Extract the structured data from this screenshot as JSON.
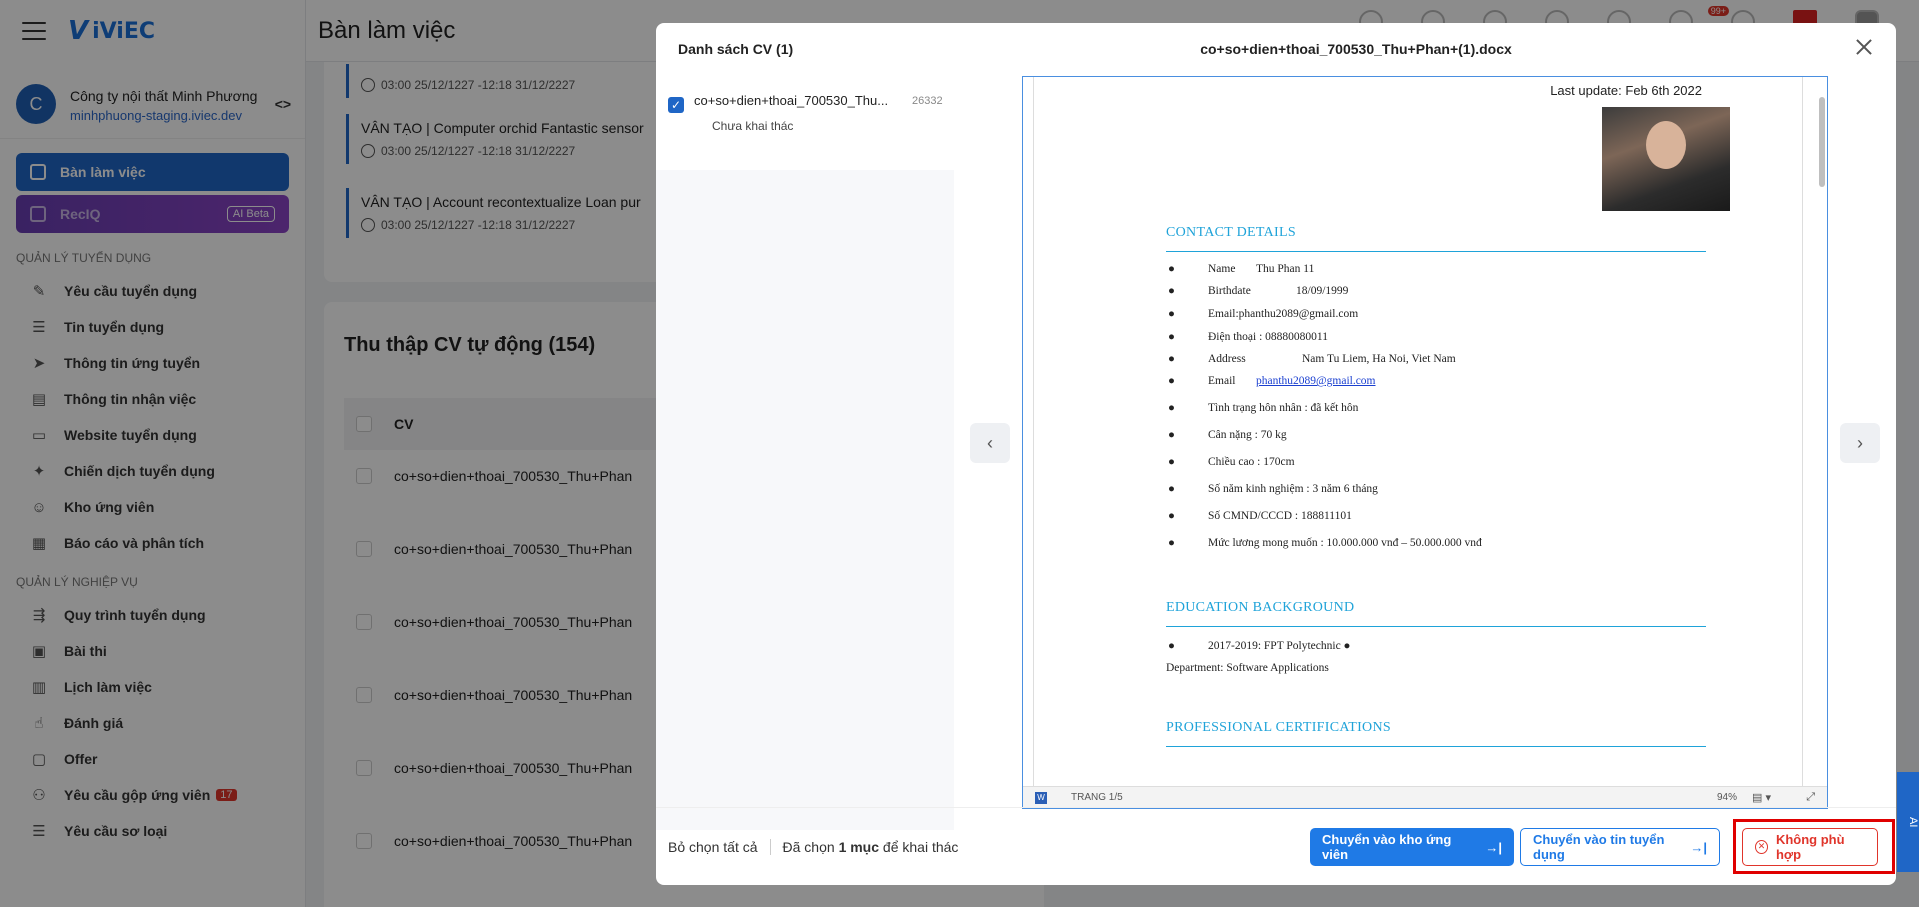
{
  "app": {
    "logo_text": "iViEC",
    "page_title": "Bàn làm việc"
  },
  "company": {
    "initial": "C",
    "name": "Công ty nội thất Minh Phương",
    "domain": "minhphuong-staging.iviec.dev"
  },
  "nav": {
    "active_label": "Bàn làm việc",
    "reciq_label": "RecIQ",
    "reciq_badge": "AI Beta",
    "section1": "QUẢN LÝ TUYỂN DỤNG",
    "section1_items": [
      "Yêu cầu tuyển dụng",
      "Tin tuyển dụng",
      "Thông tin ứng tuyển",
      "Thông tin nhận việc",
      "Website tuyển dụng",
      "Chiến dịch tuyển dụng",
      "Kho ứng viên",
      "Báo cáo và phân tích"
    ],
    "section2": "QUẢN LÝ NGHIỆP VỤ",
    "section2_items": [
      "Quy trình tuyển dụng",
      "Bài thi",
      "Lịch làm việc",
      "Đánh giá",
      "Offer",
      "Yêu cầu gộp ứng viên",
      "Yêu cầu sơ loại"
    ],
    "merge_badge": "17"
  },
  "header": {
    "notif_badge": "99+"
  },
  "tasks": [
    {
      "title": "",
      "time": "03:00 25/12/1227 -12:18 31/12/2227"
    },
    {
      "title": "VÂN TẠO | Computer orchid Fantastic sensor",
      "time": "03:00 25/12/1227 -12:18 31/12/2227"
    },
    {
      "title": "VÂN TẠO | Account recontextualize Loan pur",
      "time": "03:00 25/12/1227 -12:18 31/12/2227"
    }
  ],
  "collect": {
    "title": "Thu thập CV tự động (154)",
    "column_cv": "CV",
    "rows": [
      "co+so+dien+thoai_700530_Thu+Phan",
      "co+so+dien+thoai_700530_Thu+Phan",
      "co+so+dien+thoai_700530_Thu+Phan",
      "co+so+dien+thoai_700530_Thu+Phan",
      "co+so+dien+thoai_700530_Thu+Phan",
      "co+so+dien+thoai_700530_Thu+Phan"
    ]
  },
  "modal": {
    "list_title": "Danh sách CV (1)",
    "file_title": "co+so+dien+thoai_700530_Thu+Phan+(1).docx",
    "cv_item": {
      "name": "co+so+dien+thoai_700530_Thu...",
      "number": "26332",
      "status": "Chưa khai thác"
    },
    "doc": {
      "last_update": "Last update: Feb 6th 2022",
      "contact_title": "CONTACT DETAILS",
      "contact": [
        {
          "label": "Name",
          "value": "Thu Phan 11"
        },
        {
          "label": "Birthdate",
          "value": "18/09/1999"
        },
        {
          "label": "",
          "value": "Email:phanthu2089@gmail.com"
        },
        {
          "label": "",
          "value": "Điện thoại : 08880080011"
        },
        {
          "label": "Address",
          "value": "Nam Tu Liem, Ha Noi, Viet Nam"
        },
        {
          "label": "Email",
          "value": "phanthu2089@gmail.com"
        },
        {
          "label": "",
          "value": "Tình trạng hôn nhân : đã kết hôn"
        },
        {
          "label": "",
          "value": "Cân nặng : 70 kg"
        },
        {
          "label": "",
          "value": "Chiều cao : 170cm"
        },
        {
          "label": "",
          "value": "Số năm kinh nghiệm : 3 năm 6 tháng"
        },
        {
          "label": "",
          "value": "Số CMND/CCCD : 188811101"
        },
        {
          "label": "",
          "value": "Mức lương mong muốn : 10.000.000 vnđ – 50.000.000 vnđ"
        }
      ],
      "edu_title": "EDUCATION BACKGROUND",
      "edu_line1": "2017-2019: FPT Polytechnic ●",
      "edu_line2": "Department: Software Applications",
      "cert_title": "PROFESSIONAL CERTIFICATIONS",
      "page_count": "TRANG 1/5",
      "zoom": "94%"
    },
    "footer": {
      "deselect": "Bỏ chọn tất cả",
      "selected_prefix": "Đã chọn",
      "selected_count": "1 mục",
      "selected_suffix": "để khai thác",
      "btn_pool": "Chuyển vào kho ứng viên",
      "btn_job": "Chuyển vào tin tuyển dụng",
      "btn_reject": "Không phù hợp"
    }
  },
  "side_tab": "AI"
}
